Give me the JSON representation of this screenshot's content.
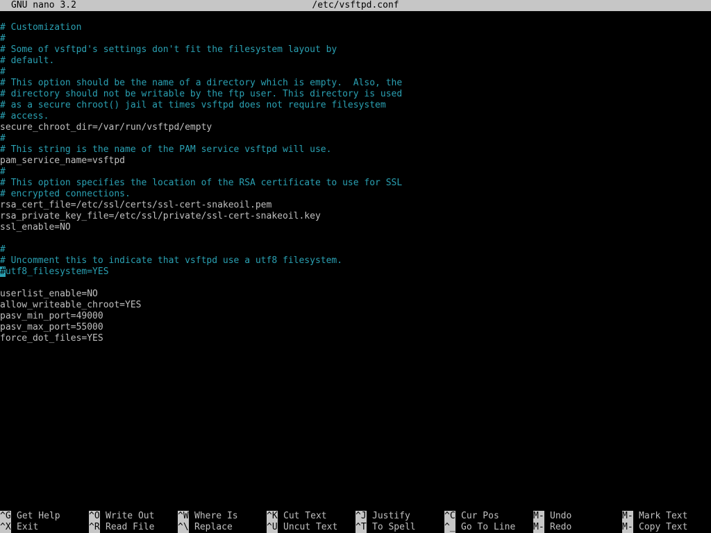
{
  "titlebar": {
    "app_version": "GNU nano 3.2",
    "file_name": "/etc/vsftpd.conf"
  },
  "editor": {
    "lines": [
      {
        "text": "# Customization",
        "kind": "comment"
      },
      {
        "text": "#",
        "kind": "comment"
      },
      {
        "text": "# Some of vsftpd's settings don't fit the filesystem layout by",
        "kind": "comment"
      },
      {
        "text": "# default.",
        "kind": "comment"
      },
      {
        "text": "#",
        "kind": "comment"
      },
      {
        "text": "# This option should be the name of a directory which is empty.  Also, the",
        "kind": "comment"
      },
      {
        "text": "# directory should not be writable by the ftp user. This directory is used",
        "kind": "comment"
      },
      {
        "text": "# as a secure chroot() jail at times vsftpd does not require filesystem",
        "kind": "comment"
      },
      {
        "text": "# access.",
        "kind": "comment"
      },
      {
        "text": "secure_chroot_dir=/var/run/vsftpd/empty",
        "kind": "setting"
      },
      {
        "text": "#",
        "kind": "comment"
      },
      {
        "text": "# This string is the name of the PAM service vsftpd will use.",
        "kind": "comment"
      },
      {
        "text": "pam_service_name=vsftpd",
        "kind": "setting"
      },
      {
        "text": "#",
        "kind": "comment"
      },
      {
        "text": "# This option specifies the location of the RSA certificate to use for SSL",
        "kind": "comment"
      },
      {
        "text": "# encrypted connections.",
        "kind": "comment"
      },
      {
        "text": "rsa_cert_file=/etc/ssl/certs/ssl-cert-snakeoil.pem",
        "kind": "setting"
      },
      {
        "text": "rsa_private_key_file=/etc/ssl/private/ssl-cert-snakeoil.key",
        "kind": "setting"
      },
      {
        "text": "ssl_enable=NO",
        "kind": "setting"
      },
      {
        "text": "",
        "kind": "blank"
      },
      {
        "text": "#",
        "kind": "comment"
      },
      {
        "text": "# Uncomment this to indicate that vsftpd use a utf8 filesystem.",
        "kind": "comment"
      },
      {
        "text": "#utf8_filesystem=YES",
        "kind": "cursor"
      },
      {
        "text": "",
        "kind": "blank"
      },
      {
        "text": "userlist_enable=NO",
        "kind": "setting"
      },
      {
        "text": "allow_writeable_chroot=YES",
        "kind": "setting"
      },
      {
        "text": "pasv_min_port=49000",
        "kind": "setting"
      },
      {
        "text": "pasv_max_port=55000",
        "kind": "setting"
      },
      {
        "text": "force_dot_files=YES",
        "kind": "setting"
      }
    ]
  },
  "shortcuts": [
    {
      "key": "^G",
      "label": "Get Help"
    },
    {
      "key": "^X",
      "label": "Exit"
    },
    {
      "key": "^O",
      "label": "Write Out"
    },
    {
      "key": "^R",
      "label": "Read File"
    },
    {
      "key": "^W",
      "label": "Where Is"
    },
    {
      "key": "^\\",
      "label": "Replace"
    },
    {
      "key": "^K",
      "label": "Cut Text"
    },
    {
      "key": "^U",
      "label": "Uncut Text"
    },
    {
      "key": "^J",
      "label": "Justify"
    },
    {
      "key": "^T",
      "label": "To Spell"
    },
    {
      "key": "^C",
      "label": "Cur Pos"
    },
    {
      "key": "^_",
      "label": "Go To Line"
    },
    {
      "key": "M-U",
      "label": "Undo"
    },
    {
      "key": "M-E",
      "label": "Redo"
    },
    {
      "key": "M-A",
      "label": "Mark Text"
    },
    {
      "key": "M-6",
      "label": "Copy Text"
    }
  ],
  "colors": {
    "background": "#000000",
    "comment": "#2aa1b3",
    "setting": "#c0c0c0",
    "bar": "#c6c6c6"
  }
}
